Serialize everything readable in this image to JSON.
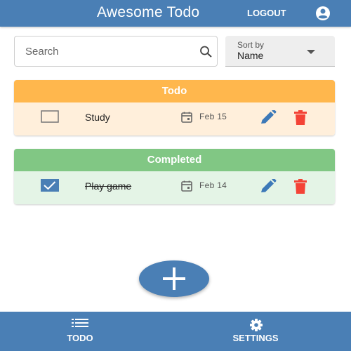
{
  "app": {
    "title": "Awesome Todo",
    "logout_label": "LOGOUT",
    "account_icon": "account-circle-icon"
  },
  "search": {
    "placeholder": "Search",
    "value": "",
    "icon": "search-icon"
  },
  "sort": {
    "label": "Sort by",
    "value": "Name"
  },
  "sections": {
    "todo": {
      "title": "Todo",
      "color": "#ffb74d",
      "items": [
        {
          "text": "Study",
          "date": "Feb 15",
          "checked": false
        }
      ]
    },
    "completed": {
      "title": "Completed",
      "color": "#81c784",
      "items": [
        {
          "text": "Play game",
          "date": "Feb 14",
          "checked": true
        }
      ]
    }
  },
  "fab": {
    "icon": "plus-icon"
  },
  "bottom_nav": {
    "todo_label": "TODO",
    "settings_label": "SETTINGS"
  },
  "colors": {
    "primary": "#4a7fb5",
    "edit": "#3d79b8",
    "delete": "#f44336"
  }
}
